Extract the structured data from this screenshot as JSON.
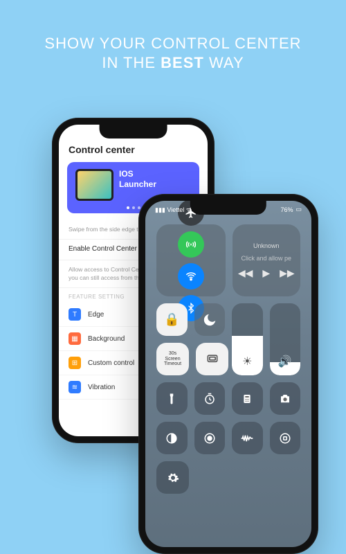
{
  "headline": {
    "line1": "SHOW YOUR CONTROL CENTER",
    "line2_pre": "IN THE ",
    "line2_bold": "BEST",
    "line2_post": " WAY"
  },
  "phoneA": {
    "title": "Control center",
    "banner": {
      "line1": "IOS",
      "line2": "Launcher"
    },
    "swipe_hint": "Swipe from the side edge to open",
    "enable_label": "Enable Control Center",
    "access_hint": "Allow access to Control Center. When disable, you can still access from the Home Screen.",
    "category": "FEATURE SETTING",
    "items": [
      {
        "label": "Edge",
        "color": "#2f7bff"
      },
      {
        "label": "Background",
        "color": "#ff6a3d"
      },
      {
        "label": "Custom control",
        "color": "#ff9f0a"
      },
      {
        "label": "Vibration",
        "color": "#2f7bff"
      }
    ]
  },
  "phoneB": {
    "status": {
      "carrier": "Viettel",
      "battery": "76%"
    },
    "media": {
      "title": "Unknown",
      "subtitle": "Click and allow pe"
    },
    "screen_timeout_top": "30s",
    "screen_timeout_label": "Screen Timeout"
  }
}
